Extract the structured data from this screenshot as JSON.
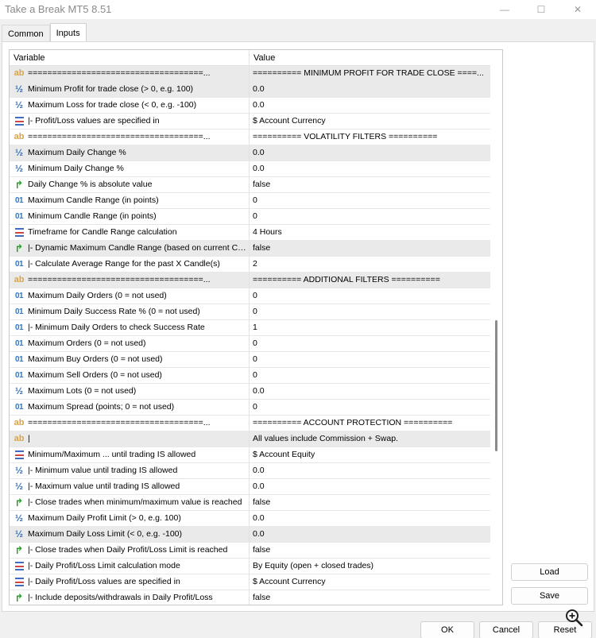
{
  "window": {
    "title": "Take a Break MT5 8.51",
    "minimize": "—",
    "maximize": "☐",
    "close": "✕"
  },
  "tabs": [
    {
      "label": "Common",
      "active": false
    },
    {
      "label": "Inputs",
      "active": true
    }
  ],
  "grid": {
    "headers": {
      "variable": "Variable",
      "value": "Value"
    },
    "rows": [
      {
        "icon": "ab",
        "variable": "====================================...",
        "value": "========== MINIMUM PROFIT FOR TRADE CLOSE ====...",
        "shade": true
      },
      {
        "icon": "half",
        "variable": "Minimum Profit for trade close (> 0, e.g. 100)",
        "value": "0.0",
        "shade": true
      },
      {
        "icon": "half",
        "variable": "Maximum Loss for trade close (< 0, e.g. -100)",
        "value": "0.0",
        "shade": false
      },
      {
        "icon": "list",
        "variable": "|- Profit/Loss values are specified in",
        "value": "$ Account Currency",
        "shade": false
      },
      {
        "icon": "ab",
        "variable": "====================================...",
        "value": "========== VOLATILITY FILTERS ==========",
        "shade": false
      },
      {
        "icon": "half",
        "variable": "Maximum Daily Change %",
        "value": "0.0",
        "shade": true
      },
      {
        "icon": "half",
        "variable": "Minimum Daily Change %",
        "value": "0.0",
        "shade": false
      },
      {
        "icon": "bool",
        "variable": "Daily Change % is absolute value",
        "value": "false",
        "shade": false
      },
      {
        "icon": "int",
        "variable": "Maximum Candle Range (in points)",
        "value": "0",
        "shade": false
      },
      {
        "icon": "int",
        "variable": "Minimum Candle Range (in points)",
        "value": "0",
        "shade": false
      },
      {
        "icon": "list",
        "variable": "Timeframe for Candle Range calculation",
        "value": "4 Hours",
        "shade": false
      },
      {
        "icon": "bool",
        "variable": "|- Dynamic Maximum Candle Range (based on current Ca...",
        "value": "false",
        "shade": true
      },
      {
        "icon": "int",
        "variable": "|- Calculate Average Range for the past X Candle(s)",
        "value": "2",
        "shade": false
      },
      {
        "icon": "ab",
        "variable": "====================================...",
        "value": "========== ADDITIONAL FILTERS ==========",
        "shade": true
      },
      {
        "icon": "int",
        "variable": "Maximum Daily Orders (0 = not used)",
        "value": "0",
        "shade": false
      },
      {
        "icon": "int",
        "variable": "Minimum Daily Success Rate % (0 = not used)",
        "value": "0",
        "shade": false
      },
      {
        "icon": "int",
        "variable": "|- Minimum Daily Orders to check Success Rate",
        "value": "1",
        "shade": false
      },
      {
        "icon": "int",
        "variable": "Maximum Orders (0 = not used)",
        "value": "0",
        "shade": false
      },
      {
        "icon": "int",
        "variable": "Maximum Buy Orders (0 = not used)",
        "value": "0",
        "shade": false
      },
      {
        "icon": "int",
        "variable": "Maximum Sell Orders (0 = not used)",
        "value": "0",
        "shade": false
      },
      {
        "icon": "half",
        "variable": "Maximum Lots (0 = not used)",
        "value": "0.0",
        "shade": false
      },
      {
        "icon": "int",
        "variable": "Maximum Spread (points; 0 = not used)",
        "value": "0",
        "shade": false
      },
      {
        "icon": "ab",
        "variable": "====================================...",
        "value": "========== ACCOUNT PROTECTION ==========",
        "shade": false
      },
      {
        "icon": "ab",
        "variable": "|",
        "value": "All values include Commission + Swap.",
        "shade": true
      },
      {
        "icon": "list",
        "variable": "Minimum/Maximum ... until trading IS allowed",
        "value": "$ Account Equity",
        "shade": false
      },
      {
        "icon": "half",
        "variable": "|- Minimum value until trading IS allowed",
        "value": "0.0",
        "shade": false
      },
      {
        "icon": "half",
        "variable": "|- Maximum value until trading IS allowed",
        "value": "0.0",
        "shade": false
      },
      {
        "icon": "bool",
        "variable": "|- Close trades when minimum/maximum value is reached",
        "value": "false",
        "shade": false
      },
      {
        "icon": "half",
        "variable": "Maximum Daily Profit Limit (> 0, e.g. 100)",
        "value": "0.0",
        "shade": false
      },
      {
        "icon": "half",
        "variable": "Maximum Daily Loss Limit (< 0, e.g. -100)",
        "value": "0.0",
        "shade": true
      },
      {
        "icon": "bool",
        "variable": "|- Close trades when Daily Profit/Loss Limit is reached",
        "value": "false",
        "shade": false
      },
      {
        "icon": "list",
        "variable": "|- Daily Profit/Loss Limit calculation mode",
        "value": "By Equity (open + closed trades)",
        "shade": false
      },
      {
        "icon": "list",
        "variable": "|- Daily Profit/Loss values are specified in",
        "value": "$ Account Currency",
        "shade": false
      },
      {
        "icon": "bool",
        "variable": "|- Include deposits/withdrawals in Daily Profit/Loss",
        "value": "false",
        "shade": false
      }
    ]
  },
  "side_buttons": {
    "load": "Load",
    "save": "Save"
  },
  "bottom_buttons": {
    "ok": "OK",
    "cancel": "Cancel",
    "reset": "Reset"
  },
  "icons": {
    "ab": "ab",
    "half": "½",
    "int": "01",
    "bool": "↱",
    "list": "list-icon",
    "zoom": "zoom-in-icon"
  },
  "colors": {
    "accent_blue": "#2f6fc0",
    "string_icon": "#d9a34a",
    "bool_icon": "#2aa02a",
    "list_red": "#d04646"
  }
}
